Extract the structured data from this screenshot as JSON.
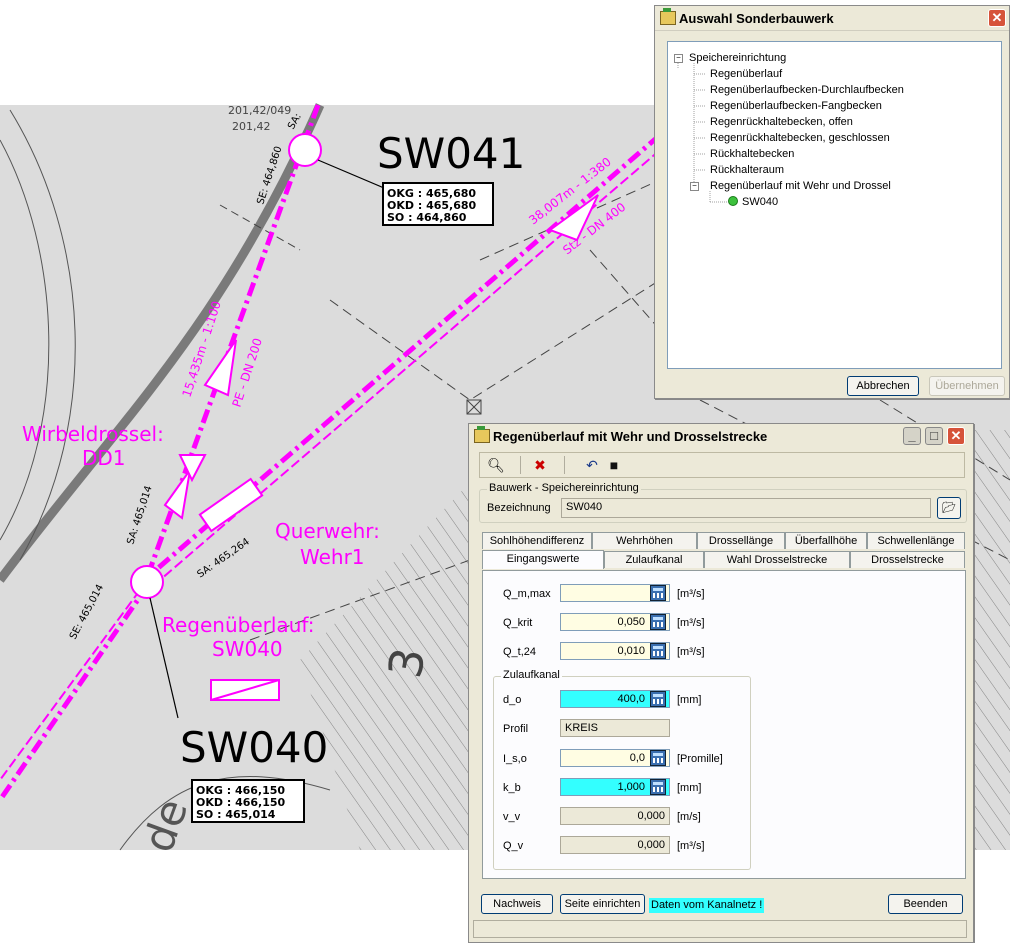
{
  "cad": {
    "sw041_label": "SW041",
    "sw041_table": [
      "OKG : 465,680",
      "OKD : 465,680",
      "SO  : 464,860"
    ],
    "sw040_label": "SW040",
    "sw040_table": [
      "OKG : 466,150",
      "OKD : 466,150",
      "SO  : 465,014"
    ],
    "wirbeldrossel_l1": "Wirbeldrossel:",
    "wirbeldrossel_l2": "DD1",
    "querwehr_l1": "Querwehr:",
    "querwehr_l2": "Wehr1",
    "regenueberlauf_l1": "Regenüberlauf:",
    "regenueberlauf_l2": "SW040",
    "pipe_top": "15,435m - 1:100",
    "pipe_top_material": "PE - DN 200",
    "pipe_right": "38,007m - 1:380",
    "pipe_right_material": "Stz - DN 400",
    "se_top": "SE: 464,860",
    "sa_top": "SA: ",
    "sa_mid": "SA: 465,014",
    "sa_right": "SA: 465,264",
    "se_bottom": "SE: 465,014",
    "parcel_top_1": "201,42/049",
    "parcel_top_2": "201,42",
    "digit": "3",
    "street_text": "de"
  },
  "tree_window": {
    "title": "Auswahl Sonderbauwerk",
    "root": "Speichereinrichtung",
    "items": [
      "Regenüberlauf",
      "Regenüberlaufbecken-Durchlaufbecken",
      "Regenüberlaufbecken-Fangbecken",
      "Regenrückhaltebecken, offen",
      "Regenrückhaltebecken, geschlossen",
      "Rückhaltebecken",
      "Rückhalteraum"
    ],
    "expanded": "Regenüberlauf mit Wehr und Drossel",
    "child": "SW040",
    "cancel": "Abbrechen",
    "apply": "Übernehmen"
  },
  "dialog": {
    "title": "Regenüberlauf mit Wehr und Drosselstrecke",
    "group_title": "Bauwerk - Speichereinrichtung",
    "bezeichnung_label": "Bezeichnung",
    "bezeichnung_value": "SW040",
    "tabs_row1": [
      "Sohlhöhendifferenz",
      "Wehrhöhen",
      "Drossellänge",
      "Überfallhöhe",
      "Schwellenlänge"
    ],
    "tabs_row2": [
      "Eingangswerte",
      "Zulaufkanal",
      "Wahl Drosselstrecke",
      "Drosselstrecke"
    ],
    "fields": {
      "qm_label": "Q_m,max",
      "qm_value": "",
      "qm_unit": "[m³/s]",
      "qkrit_label": "Q_krit",
      "qkrit_value": "0,050",
      "qkrit_unit": "[m³/s]",
      "qt_label": "Q_t,24",
      "qt_value": "0,010",
      "qt_unit": "[m³/s]"
    },
    "zulauf": {
      "title": "Zulaufkanal",
      "do_label": "d_o",
      "do_value": "400,0",
      "do_unit": "[mm]",
      "profil_label": "Profil",
      "profil_value": "KREIS",
      "iso_label": "I_s,o",
      "iso_value": "0,0",
      "iso_unit": "[Promille]",
      "kb_label": "k_b",
      "kb_value": "1,000",
      "kb_unit": "[mm]",
      "vv_label": "v_v",
      "vv_value": "0,000",
      "vv_unit": "[m/s]",
      "qv_label": "Q_v",
      "qv_value": "0,000",
      "qv_unit": "[m³/s]"
    },
    "buttons": {
      "nachweis": "Nachweis",
      "seite": "Seite einrichten",
      "status": "Daten vom Kanalnetz !",
      "beenden": "Beenden"
    }
  },
  "colors": {
    "magenta": "#ff00ff",
    "cyan": "#33ffff",
    "xp_face": "#ece9d8"
  }
}
